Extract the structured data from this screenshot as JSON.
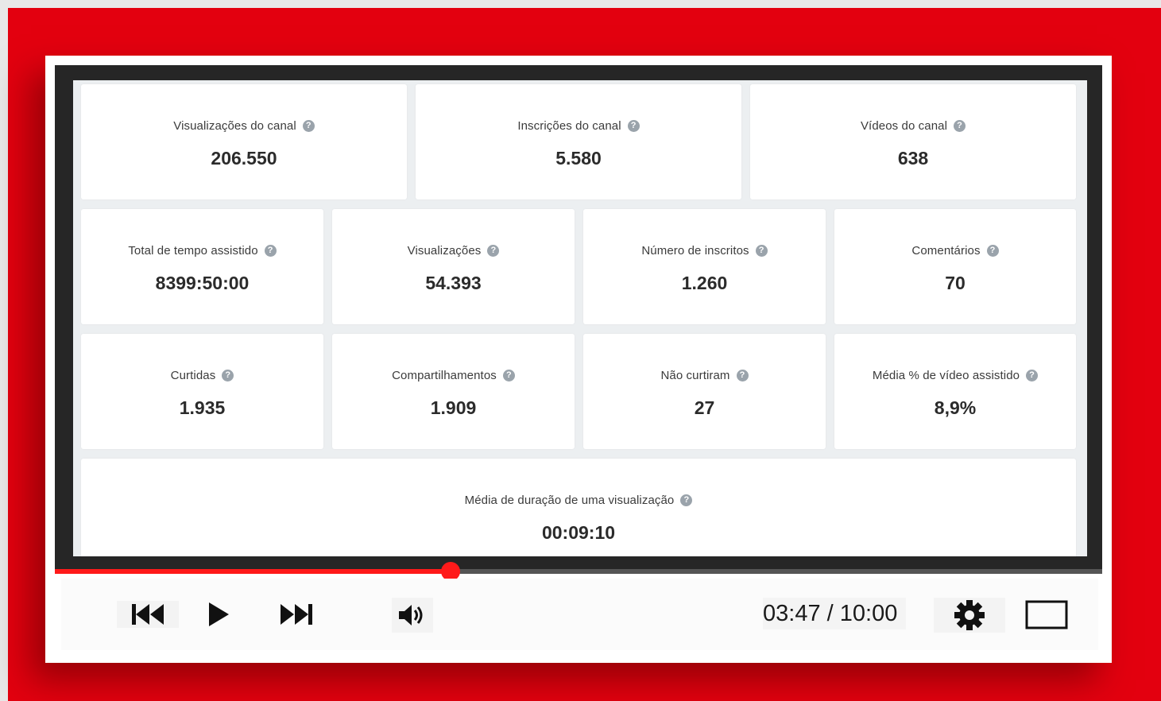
{
  "dashboard": {
    "row1": [
      {
        "label": "Visualizações do canal",
        "value": "206.550"
      },
      {
        "label": "Inscrições do canal",
        "value": "5.580"
      },
      {
        "label": "Vídeos do canal",
        "value": "638"
      }
    ],
    "row2": [
      {
        "label": "Total de tempo assistido",
        "value": "8399:50:00"
      },
      {
        "label": "Visualizações",
        "value": "54.393"
      },
      {
        "label": "Número de inscritos",
        "value": "1.260"
      },
      {
        "label": "Comentários",
        "value": "70"
      }
    ],
    "row3": [
      {
        "label": "Curtidas",
        "value": "1.935"
      },
      {
        "label": "Compartilhamentos",
        "value": "1.909"
      },
      {
        "label": "Não curtiram",
        "value": "27"
      },
      {
        "label": "Média % de vídeo assistido",
        "value": "8,9%"
      }
    ],
    "row4": [
      {
        "label": "Média de duração de uma visualização",
        "value": "00:09:10"
      }
    ],
    "help_icon": "question-circle-icon"
  },
  "player": {
    "current_time": "03:47",
    "separator": " / ",
    "duration": "10:00",
    "progress_fraction": 0.378,
    "accent_color": "#ff1a1a",
    "icons": {
      "previous": "skip-previous-icon",
      "play": "play-icon",
      "next": "skip-next-icon",
      "volume": "volume-icon",
      "settings": "gear-icon",
      "fullscreen": "fullscreen-icon"
    }
  }
}
